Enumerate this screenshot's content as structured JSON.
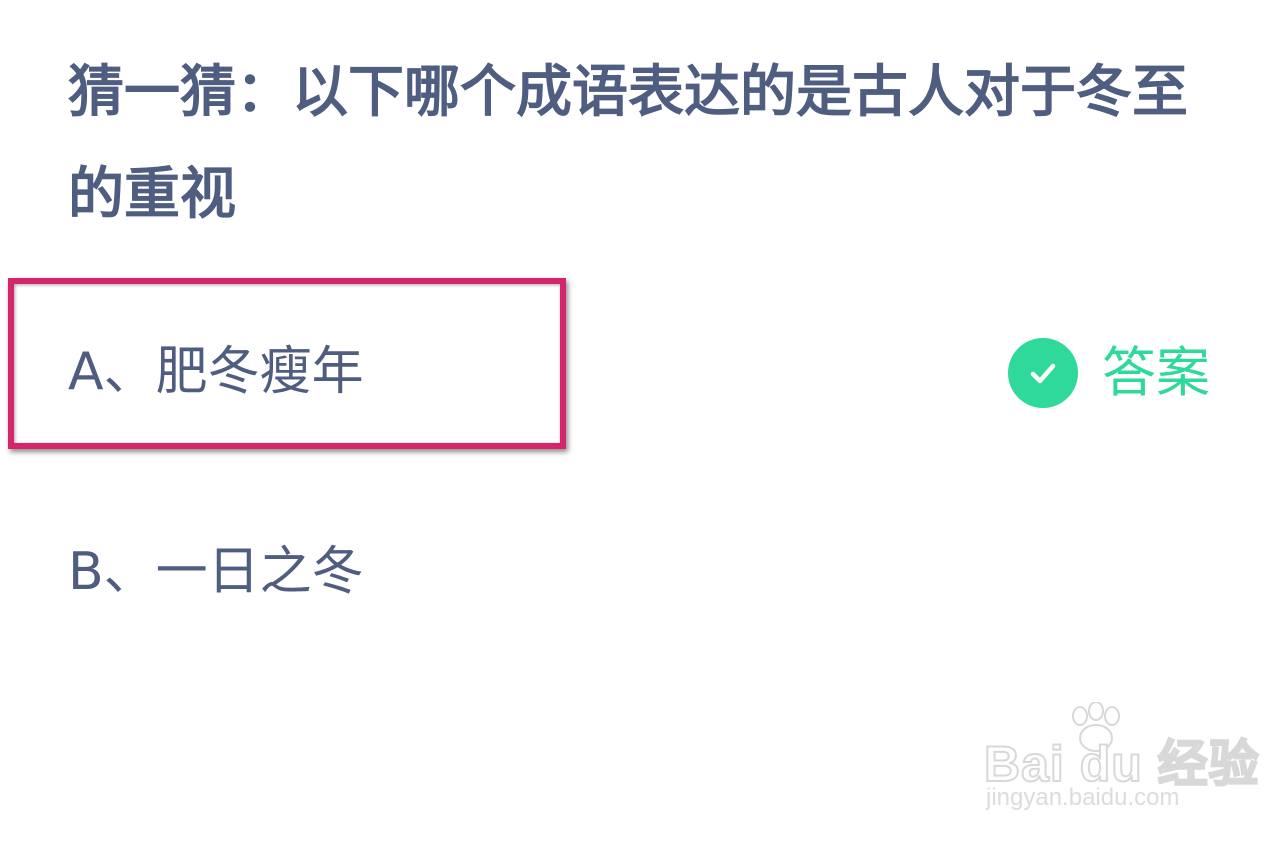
{
  "question": {
    "text": "猜一猜：以下哪个成语表达的是古人对于冬至的重视"
  },
  "options": [
    {
      "label": "A、肥冬瘦年"
    },
    {
      "label": "B、一日之冬"
    }
  ],
  "answer": {
    "label": "答案",
    "icon": "check-circle-icon"
  },
  "watermark": {
    "brand": "Bai du 经验",
    "url": "jingyan.baidu.com"
  },
  "colors": {
    "text": "#4f5d80",
    "accent": "#2fd99a",
    "highlight": "#d6266b"
  }
}
